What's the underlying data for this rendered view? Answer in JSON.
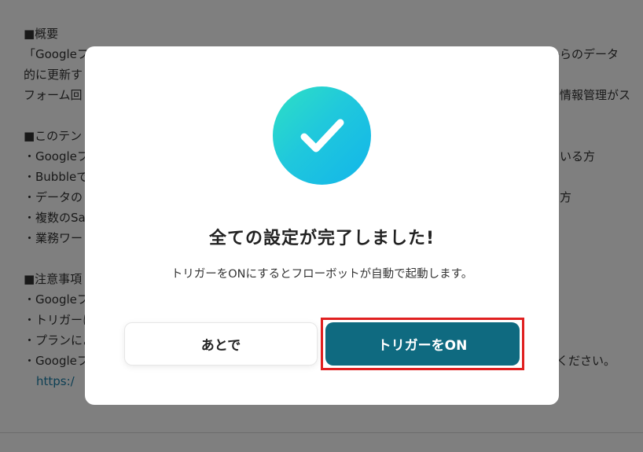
{
  "background": {
    "lines": [
      {
        "left": "■概要",
        "right": ""
      },
      {
        "left": "「Googleフ",
        "right": "ムからのデータ"
      },
      {
        "left": "的に更新す",
        "right": ""
      },
      {
        "left": "フォーム回",
        "right": "情報管理がス"
      },
      {
        "left": "",
        "right": ""
      },
      {
        "left": "■このテン",
        "right": ""
      },
      {
        "left": "・Googleフ",
        "right": "いる方"
      },
      {
        "left": "・Bubbleで",
        "right": ""
      },
      {
        "left": "・データの",
        "right": "方"
      },
      {
        "left": "・複数のSa",
        "right": ""
      },
      {
        "left": "・業務ワー",
        "right": ""
      },
      {
        "left": "",
        "right": ""
      },
      {
        "left": "■注意事項",
        "right": ""
      },
      {
        "left": "・Googleフ",
        "right": ""
      },
      {
        "left": "・トリガーは",
        "right": ""
      },
      {
        "left": "・プランによ",
        "right": ""
      },
      {
        "left": "・Googleフ",
        "right": "ください。"
      }
    ],
    "link_text": "https:/"
  },
  "modal": {
    "title": "全ての設定が完了しました!",
    "subtitle": "トリガーをONにするとフローボットが自動で起動します。",
    "later_button": "あとで",
    "on_button": "トリガーをON",
    "icon": "check-circle-icon"
  },
  "colors": {
    "primary_button": "#0f6a80",
    "highlight_border": "#e02020",
    "check_gradient_start": "#2ee0c4",
    "check_gradient_end": "#12b5ea"
  }
}
